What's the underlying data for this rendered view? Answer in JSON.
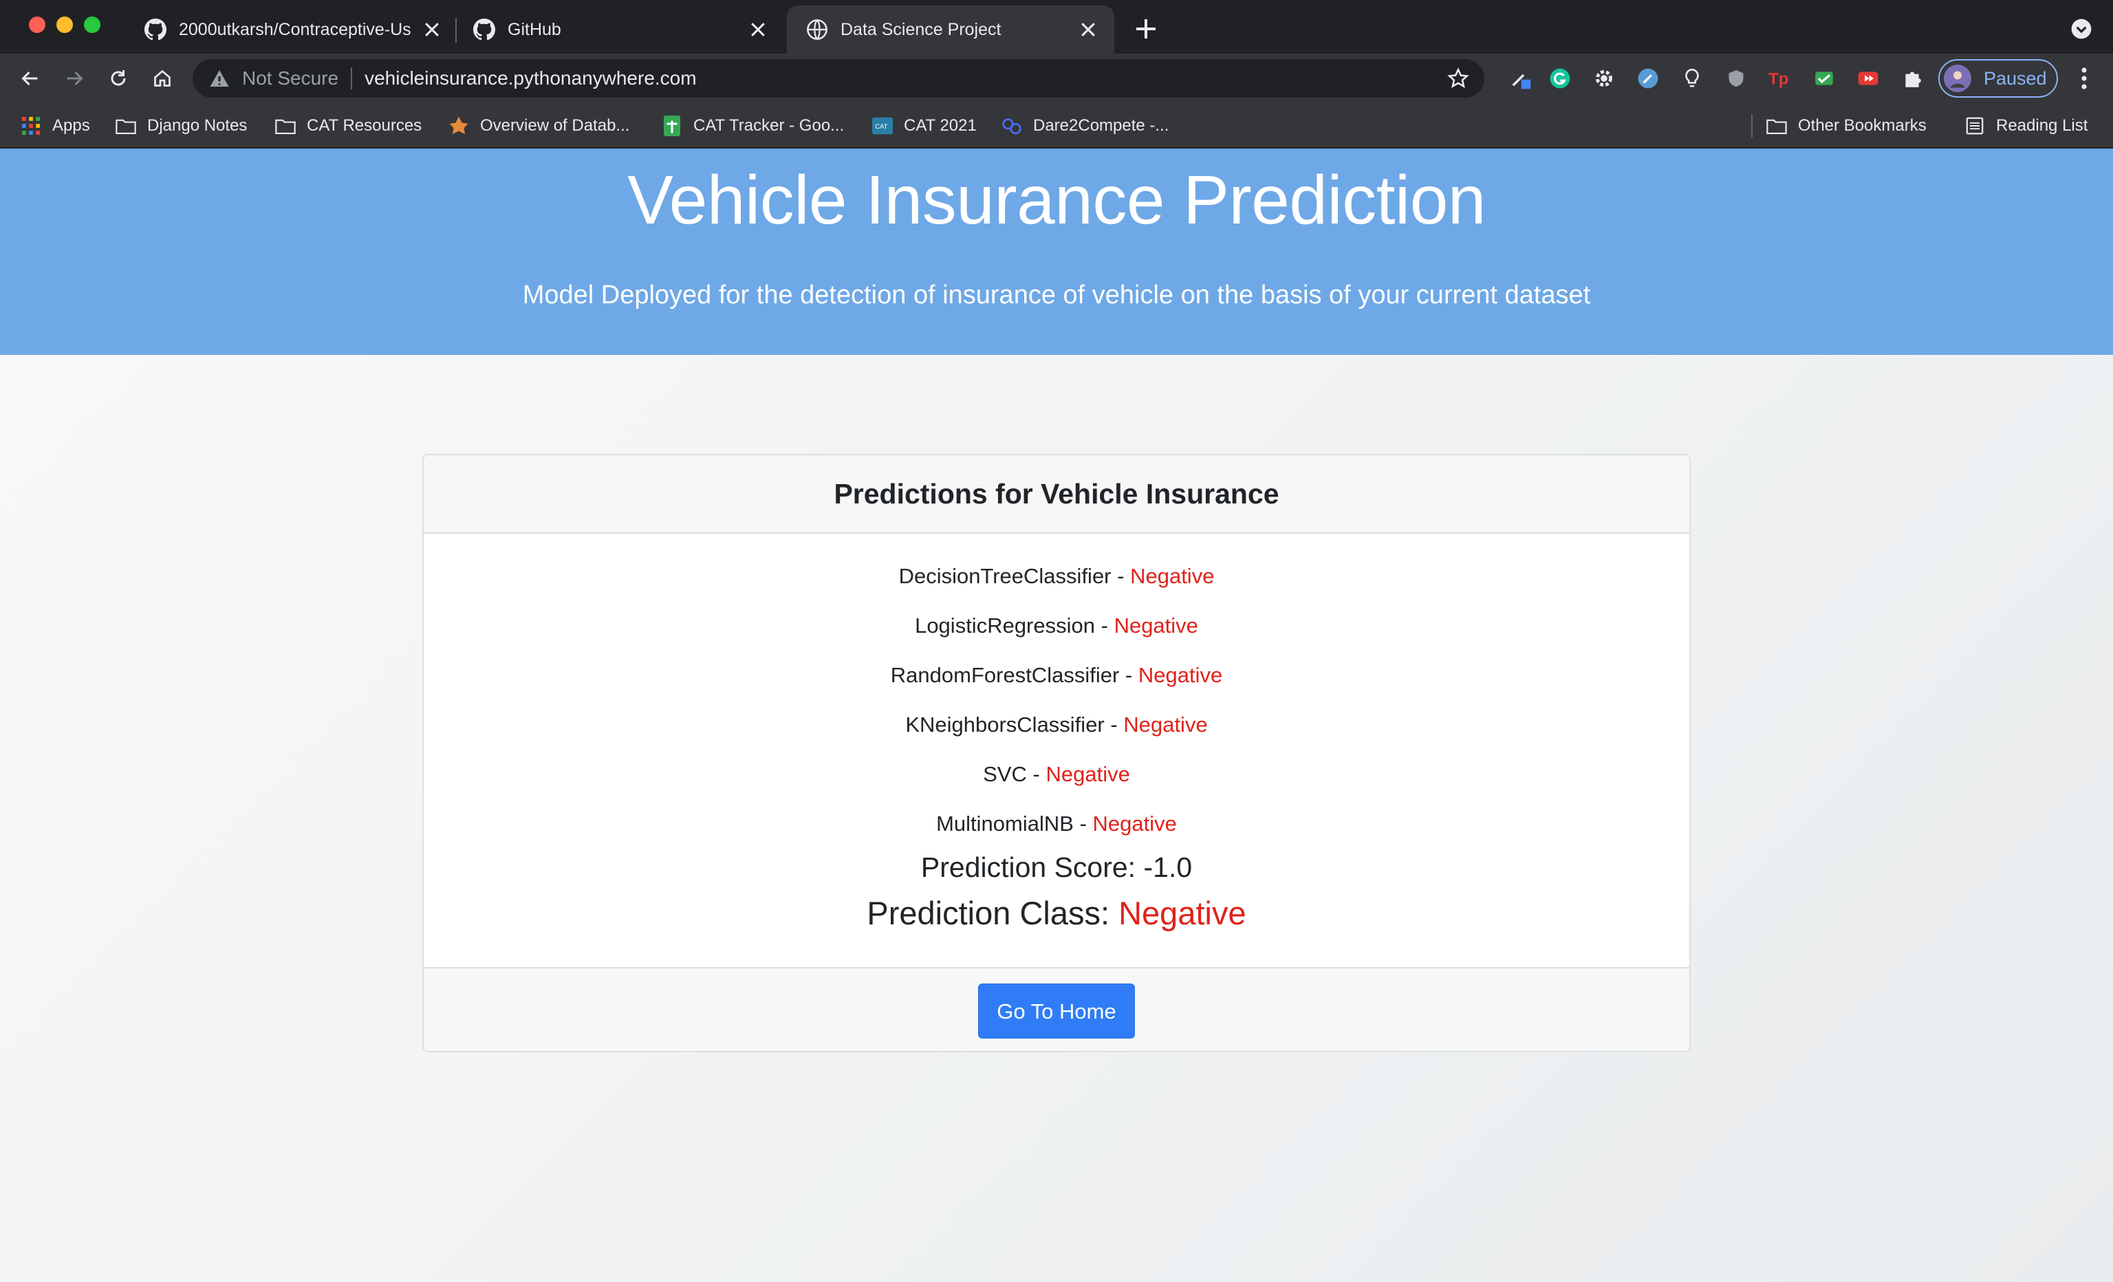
{
  "browser": {
    "tabs": [
      {
        "title": "2000utkarsh/Contraceptive-Us",
        "icon": "github-icon",
        "active": false
      },
      {
        "title": "GitHub",
        "icon": "github-icon",
        "active": false
      },
      {
        "title": "Data Science Project",
        "icon": "globe-icon",
        "active": true
      }
    ],
    "address_bar": {
      "security_label": "Not Secure",
      "url": "vehicleinsurance.pythonanywhere.com"
    },
    "profile_label": "Paused",
    "bookmarks": [
      {
        "label": "Apps",
        "icon": "apps-grid-icon"
      },
      {
        "label": "Django Notes",
        "icon": "folder-icon"
      },
      {
        "label": "CAT Resources",
        "icon": "folder-icon"
      },
      {
        "label": "Overview of Datab...",
        "icon": "site-icon"
      },
      {
        "label": "CAT Tracker - Goo...",
        "icon": "sheets-icon"
      },
      {
        "label": "CAT 2021",
        "icon": "cat-icon"
      },
      {
        "label": "Dare2Compete -...",
        "icon": "site-icon"
      }
    ],
    "bookmarks_right": [
      {
        "label": "Other Bookmarks",
        "icon": "folder-icon"
      },
      {
        "label": "Reading List",
        "icon": "reading-list-icon"
      }
    ]
  },
  "page": {
    "title": "Vehicle Insurance Prediction",
    "subtitle": "Model Deployed for the detection of insurance of vehicle on the basis of your current dataset",
    "card_title": "Predictions for Vehicle Insurance",
    "separator": " - ",
    "predictions": [
      {
        "model": "DecisionTreeClassifier",
        "result": "Negative"
      },
      {
        "model": "LogisticRegression",
        "result": "Negative"
      },
      {
        "model": "RandomForestClassifier",
        "result": "Negative"
      },
      {
        "model": "KNeighborsClassifier",
        "result": "Negative"
      },
      {
        "model": "SVC",
        "result": "Negative"
      },
      {
        "model": "MultinomialNB",
        "result": "Negative"
      }
    ],
    "score_label": "Prediction Score:",
    "score_value": "-1.0",
    "class_label": "Prediction Class:",
    "class_value": "Negative",
    "home_button": "Go To Home"
  },
  "colors": {
    "banner": "#6ea8e6",
    "negative": "#e0221b",
    "button": "#2f7cf6"
  }
}
